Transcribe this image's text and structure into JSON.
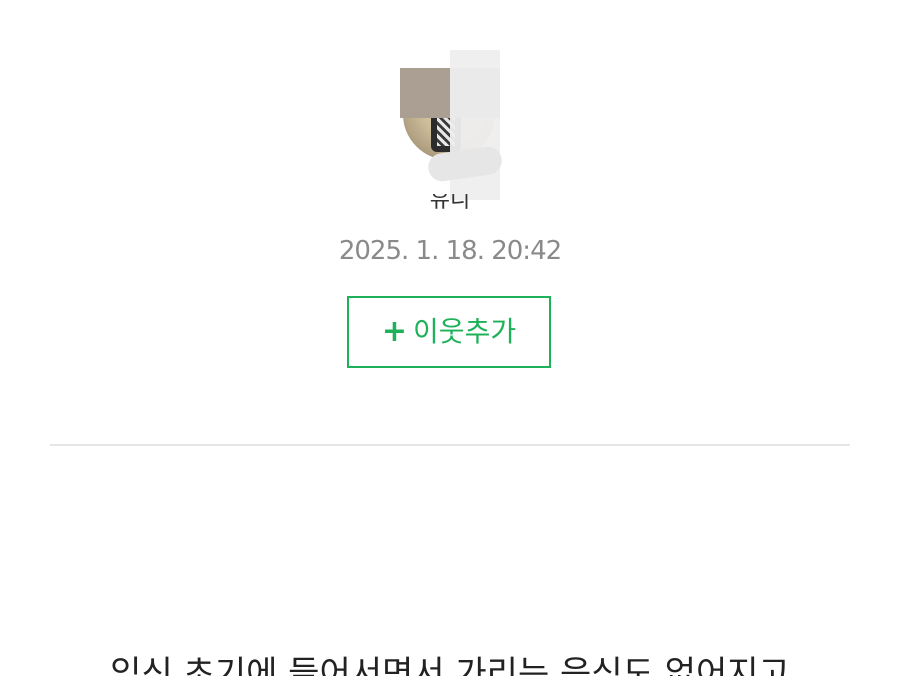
{
  "profile": {
    "author_name": "유니",
    "post_date": "2025. 1. 18. 20:42",
    "add_neighbor_label": "이웃추가",
    "add_neighbor_icon": "plus-icon"
  },
  "post": {
    "first_line": "임신 초기에 들어서면서 가리는 음식도 없어지고"
  },
  "colors": {
    "accent_green": "#1fb15a",
    "date_gray": "#8a8a8a",
    "divider": "#e6e6e6"
  }
}
